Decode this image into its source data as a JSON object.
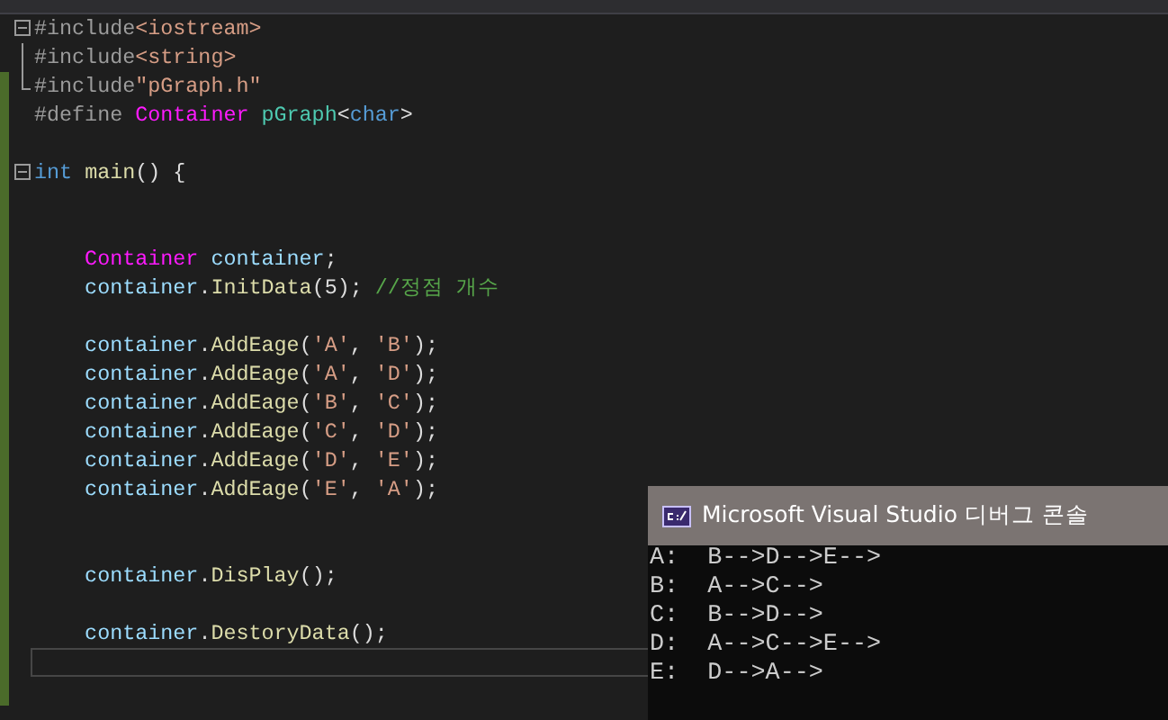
{
  "editor": {
    "lines": [
      {
        "modified": false,
        "kind": "opener",
        "tokens": [
          {
            "kind": "pp",
            "t": "#include"
          },
          {
            "kind": "str",
            "t": "<iostream>"
          }
        ]
      },
      {
        "modified": false,
        "kind": "inside",
        "tokens": [
          {
            "kind": "pp",
            "t": "#include"
          },
          {
            "kind": "str",
            "t": "<string>"
          }
        ]
      },
      {
        "modified": true,
        "kind": "closer",
        "tokens": [
          {
            "kind": "pp",
            "t": "#include"
          },
          {
            "kind": "str",
            "t": "\"pGraph.h\""
          }
        ]
      },
      {
        "modified": true,
        "tokens": [
          {
            "kind": "pp",
            "t": "#define "
          },
          {
            "kind": "macro",
            "t": "Container "
          },
          {
            "kind": "type",
            "t": "pGraph"
          },
          {
            "kind": "plain",
            "t": "<"
          },
          {
            "kind": "kw",
            "t": "char"
          },
          {
            "kind": "plain",
            "t": ">"
          }
        ]
      },
      {
        "modified": true
      },
      {
        "modified": true,
        "kind": "opener",
        "tokens": [
          {
            "kind": "kw",
            "t": "int "
          },
          {
            "kind": "fn",
            "t": "main"
          },
          {
            "kind": "plain",
            "t": "() {"
          }
        ]
      },
      {
        "modified": true
      },
      {
        "modified": true
      },
      {
        "modified": true,
        "tokens": [
          {
            "kind": "macro",
            "t": "    Container "
          },
          {
            "kind": "var",
            "t": "container"
          },
          {
            "kind": "plain",
            "t": ";"
          }
        ]
      },
      {
        "modified": true,
        "tokens": [
          {
            "kind": "var",
            "t": "    container"
          },
          {
            "kind": "plain",
            "t": "."
          },
          {
            "kind": "fn",
            "t": "InitData"
          },
          {
            "kind": "plain",
            "t": "(5); "
          },
          {
            "kind": "cmt",
            "t": "//정점 개수"
          }
        ]
      },
      {
        "modified": true
      },
      {
        "modified": true,
        "tokens": [
          {
            "kind": "var",
            "t": "    container"
          },
          {
            "kind": "plain",
            "t": "."
          },
          {
            "kind": "fn",
            "t": "AddEage"
          },
          {
            "kind": "plain",
            "t": "("
          },
          {
            "kind": "str",
            "t": "'A'"
          },
          {
            "kind": "plain",
            "t": ", "
          },
          {
            "kind": "str",
            "t": "'B'"
          },
          {
            "kind": "plain",
            "t": ");"
          }
        ]
      },
      {
        "modified": true,
        "tokens": [
          {
            "kind": "var",
            "t": "    container"
          },
          {
            "kind": "plain",
            "t": "."
          },
          {
            "kind": "fn",
            "t": "AddEage"
          },
          {
            "kind": "plain",
            "t": "("
          },
          {
            "kind": "str",
            "t": "'A'"
          },
          {
            "kind": "plain",
            "t": ", "
          },
          {
            "kind": "str",
            "t": "'D'"
          },
          {
            "kind": "plain",
            "t": ");"
          }
        ]
      },
      {
        "modified": true,
        "tokens": [
          {
            "kind": "var",
            "t": "    container"
          },
          {
            "kind": "plain",
            "t": "."
          },
          {
            "kind": "fn",
            "t": "AddEage"
          },
          {
            "kind": "plain",
            "t": "("
          },
          {
            "kind": "str",
            "t": "'B'"
          },
          {
            "kind": "plain",
            "t": ", "
          },
          {
            "kind": "str",
            "t": "'C'"
          },
          {
            "kind": "plain",
            "t": ");"
          }
        ]
      },
      {
        "modified": true,
        "tokens": [
          {
            "kind": "var",
            "t": "    container"
          },
          {
            "kind": "plain",
            "t": "."
          },
          {
            "kind": "fn",
            "t": "AddEage"
          },
          {
            "kind": "plain",
            "t": "("
          },
          {
            "kind": "str",
            "t": "'C'"
          },
          {
            "kind": "plain",
            "t": ", "
          },
          {
            "kind": "str",
            "t": "'D'"
          },
          {
            "kind": "plain",
            "t": ");"
          }
        ]
      },
      {
        "modified": true,
        "tokens": [
          {
            "kind": "var",
            "t": "    container"
          },
          {
            "kind": "plain",
            "t": "."
          },
          {
            "kind": "fn",
            "t": "AddEage"
          },
          {
            "kind": "plain",
            "t": "("
          },
          {
            "kind": "str",
            "t": "'D'"
          },
          {
            "kind": "plain",
            "t": ", "
          },
          {
            "kind": "str",
            "t": "'E'"
          },
          {
            "kind": "plain",
            "t": ");"
          }
        ]
      },
      {
        "modified": true,
        "tokens": [
          {
            "kind": "var",
            "t": "    container"
          },
          {
            "kind": "plain",
            "t": "."
          },
          {
            "kind": "fn",
            "t": "AddEage"
          },
          {
            "kind": "plain",
            "t": "("
          },
          {
            "kind": "str",
            "t": "'E'"
          },
          {
            "kind": "plain",
            "t": ", "
          },
          {
            "kind": "str",
            "t": "'A'"
          },
          {
            "kind": "plain",
            "t": ");"
          }
        ]
      },
      {
        "modified": true
      },
      {
        "modified": true
      },
      {
        "modified": true,
        "tokens": [
          {
            "kind": "var",
            "t": "    container"
          },
          {
            "kind": "plain",
            "t": "."
          },
          {
            "kind": "fn",
            "t": "DisPlay"
          },
          {
            "kind": "plain",
            "t": "();"
          }
        ]
      },
      {
        "modified": true
      },
      {
        "modified": true,
        "tokens": [
          {
            "kind": "var",
            "t": "    container"
          },
          {
            "kind": "plain",
            "t": "."
          },
          {
            "kind": "fn",
            "t": "DestoryData"
          },
          {
            "kind": "plain",
            "t": "();"
          }
        ]
      },
      {
        "modified": true,
        "current": true
      },
      {
        "modified": true
      }
    ]
  },
  "console": {
    "title": "Microsoft Visual Studio 디버그 콘솔",
    "lines": [
      "A:  B-->D-->E-->",
      "B:  A-->C-->",
      "C:  B-->D-->",
      "D:  A-->C-->E-->",
      "E:  D-->A-->"
    ]
  }
}
